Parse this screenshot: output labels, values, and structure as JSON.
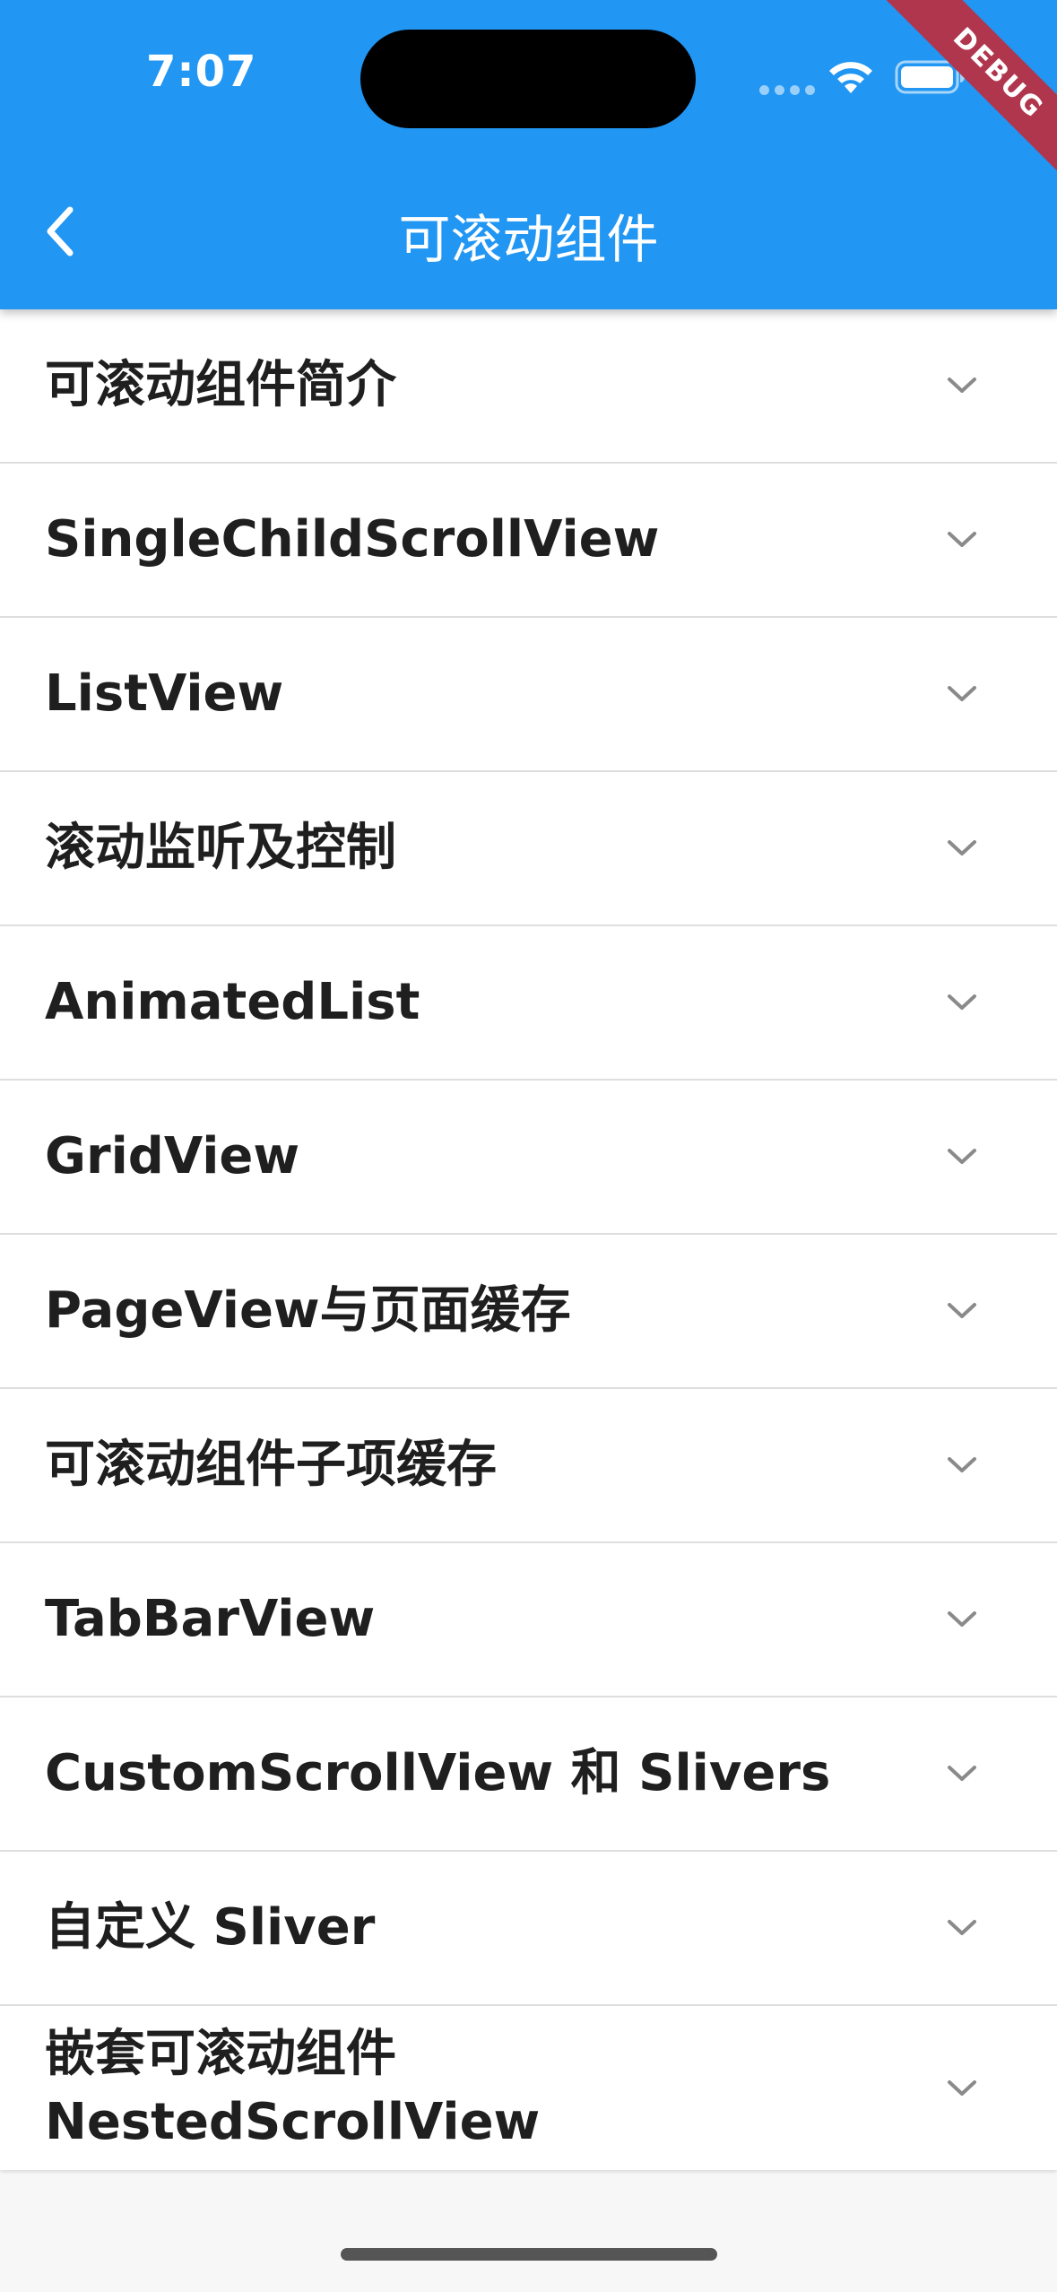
{
  "status_bar": {
    "time": "7:07"
  },
  "debug_banner": "DEBUG",
  "app_bar": {
    "title": "可滚动组件",
    "back_icon": "chevron-left-icon"
  },
  "list": {
    "items": [
      {
        "label": "可滚动组件简介"
      },
      {
        "label": "SingleChildScrollView"
      },
      {
        "label": "ListView"
      },
      {
        "label": "滚动监听及控制"
      },
      {
        "label": "AnimatedList"
      },
      {
        "label": "GridView"
      },
      {
        "label": "PageView与页面缓存"
      },
      {
        "label": "可滚动组件子项缓存"
      },
      {
        "label": "TabBarView"
      },
      {
        "label": "CustomScrollView 和 Slivers"
      },
      {
        "label": "自定义 Sliver"
      },
      {
        "label": "嵌套可滚动组件\nNestedScrollView"
      }
    ],
    "expand_icon": "chevron-down-icon"
  },
  "colors": {
    "app_bar": "#2196f3",
    "debug_ribbon": "#b0364e",
    "row_text": "#1f1f1f",
    "divider": "#dedede"
  }
}
